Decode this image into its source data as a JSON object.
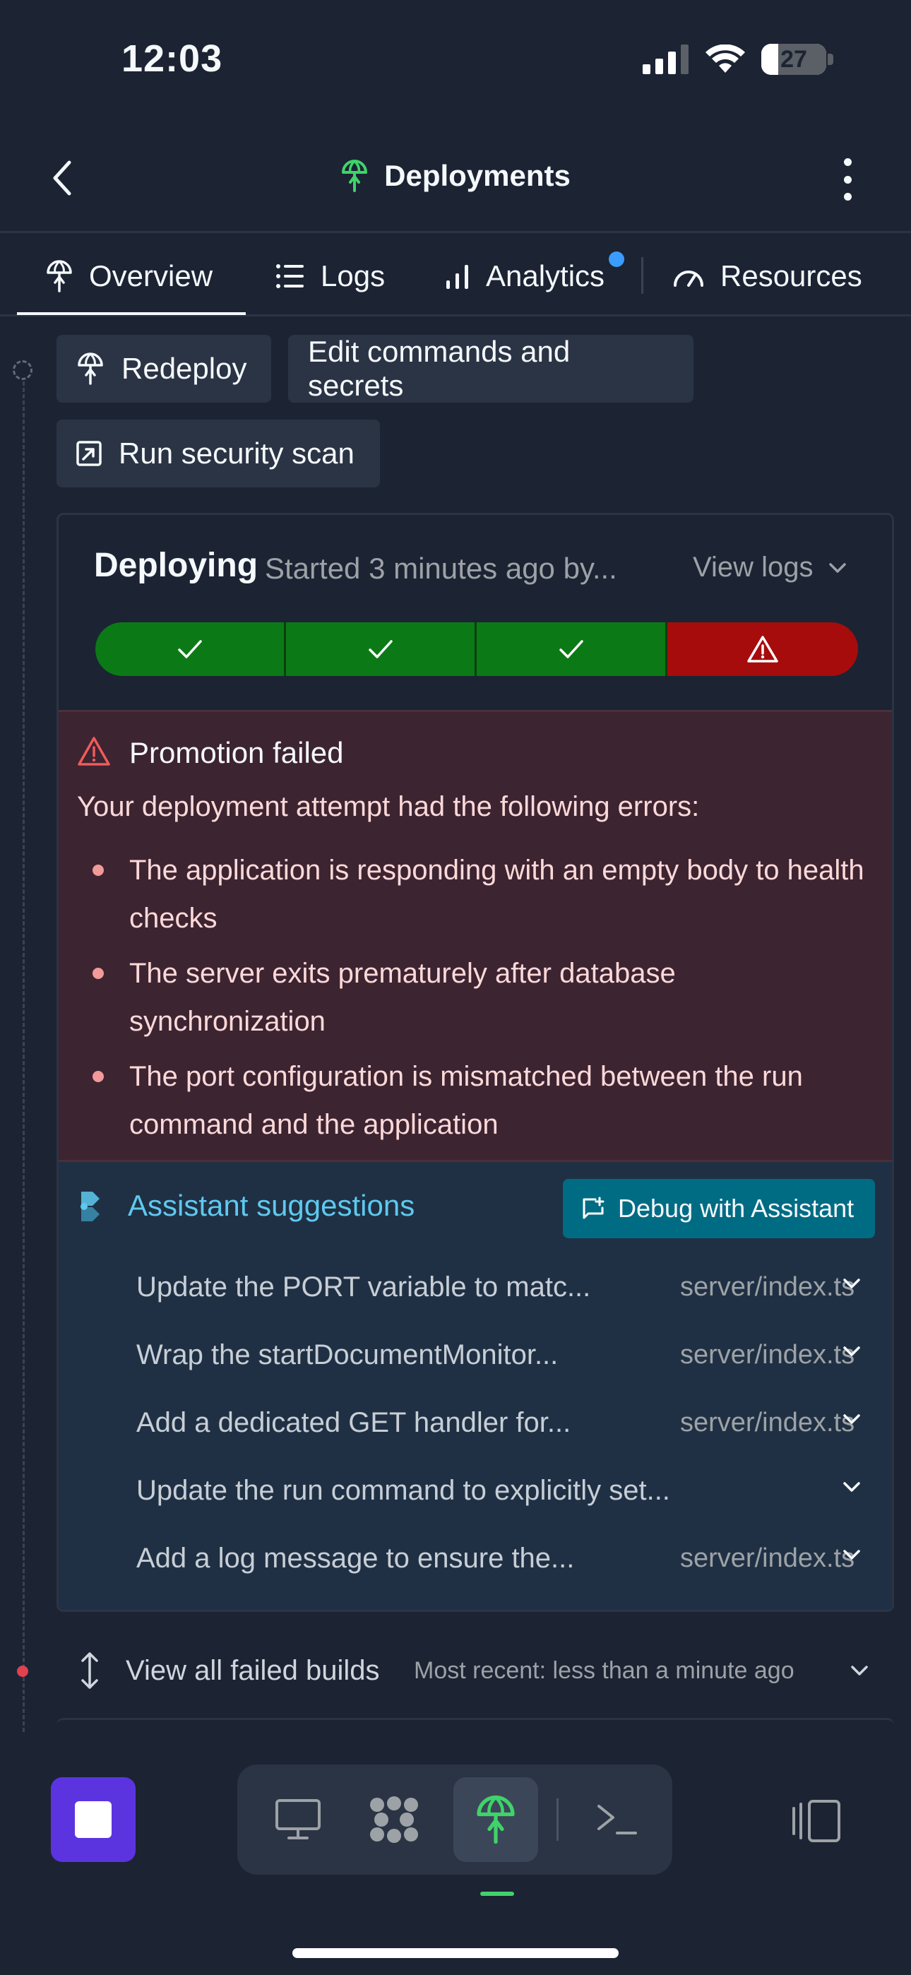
{
  "status_bar": {
    "time": "12:03",
    "battery": "27"
  },
  "header": {
    "title": "Deployments",
    "icons": [
      "back-chevron-icon",
      "deployments-icon",
      "more-vertical-icon"
    ]
  },
  "tabs": [
    {
      "label": "Overview",
      "icon": "deployments-icon",
      "active": true
    },
    {
      "label": "Logs",
      "icon": "list-icon"
    },
    {
      "label": "Analytics",
      "icon": "bar-chart-icon",
      "badge": true
    },
    {
      "label": "Resources",
      "icon": "gauge-icon"
    }
  ],
  "actions": {
    "redeploy": "Redeploy",
    "edit": "Edit commands and secrets",
    "scan": "Run security scan"
  },
  "deployment": {
    "status": "Deploying",
    "started": "Started 3 minutes ago by...",
    "view_logs": "View logs",
    "steps": [
      "success",
      "success",
      "success",
      "error"
    ]
  },
  "error": {
    "title": "Promotion failed",
    "intro": "Your deployment attempt had the following errors:",
    "items": [
      "The application is responding with an empty body to health checks",
      "The server exits prematurely after database synchronization",
      "The port configuration is mismatched between the run command and the application"
    ]
  },
  "assistant": {
    "title": "Assistant suggestions",
    "debug_button": "Debug with Assistant",
    "suggestions": [
      {
        "text": "Update the PORT variable to matc...",
        "file": "server/index.ts"
      },
      {
        "text": "Wrap the startDocumentMonitor...",
        "file": "server/index.ts"
      },
      {
        "text": "Add a dedicated GET handler for...",
        "file": "server/index.ts"
      },
      {
        "text": "Update the run command to explicitly set...",
        "file": ""
      },
      {
        "text": "Add a log message to ensure the...",
        "file": "server/index.ts"
      }
    ]
  },
  "failed_builds": {
    "label": "View all failed builds",
    "subtitle": "Most recent: less than a minute ago"
  },
  "colors": {
    "background": "#1c2333",
    "success": "#0b7a16",
    "error": "#a60c0c",
    "accent": "#5b34e0",
    "assistant_text": "#5ec9ee"
  }
}
